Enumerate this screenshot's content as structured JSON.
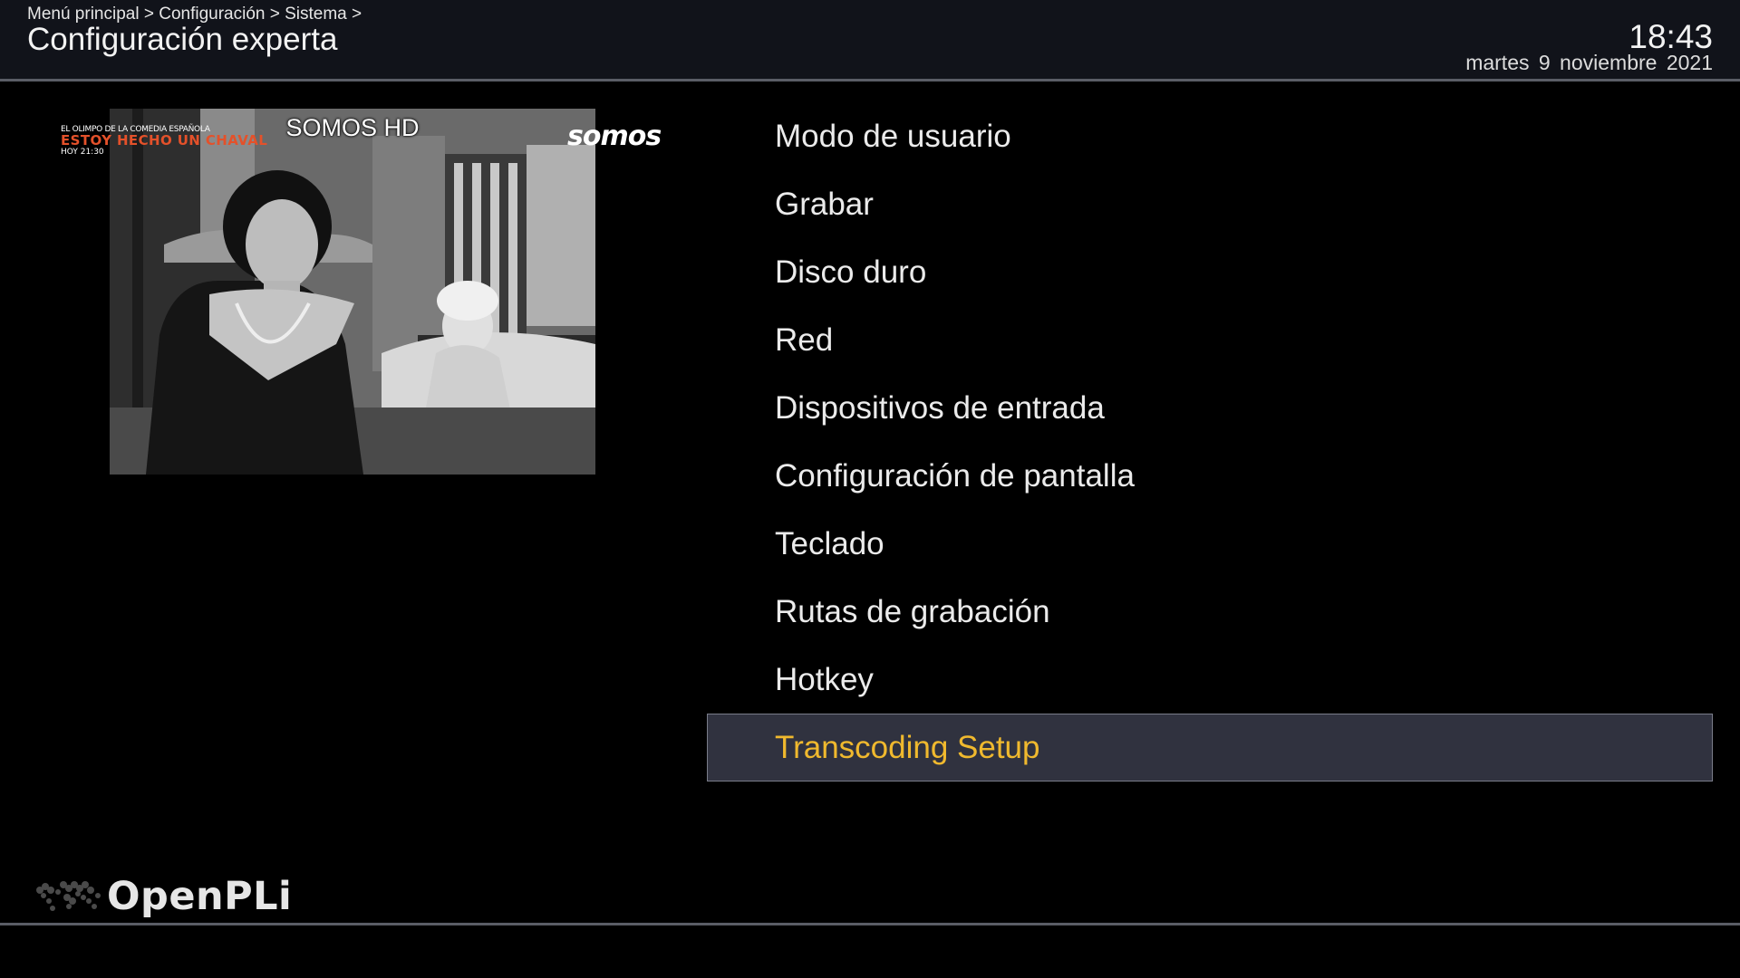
{
  "header": {
    "breadcrumb": "Menú principal > Configuración > Sistema >",
    "title": "Configuración experta",
    "time": "18:43",
    "date": "martes  9 noviembre 2021"
  },
  "preview": {
    "channel_name": "SOMOS HD",
    "promo_line1": "EL OLIMPO DE LA COMEDIA ESPAÑOLA",
    "promo_line2": "ESTOY HECHO UN CHAVAL",
    "promo_line3": "HOY 21:30",
    "channel_logo": "somos"
  },
  "menu": {
    "items": [
      {
        "label": "Modo de usuario"
      },
      {
        "label": "Grabar"
      },
      {
        "label": "Disco duro"
      },
      {
        "label": "Red"
      },
      {
        "label": "Dispositivos de entrada"
      },
      {
        "label": "Configuración de pantalla"
      },
      {
        "label": "Teclado"
      },
      {
        "label": "Rutas de grabación"
      },
      {
        "label": "Hotkey"
      },
      {
        "label": "Transcoding Setup"
      }
    ],
    "selected_index": 9
  },
  "footer": {
    "brand": "OpenPLi",
    "logo_icon": "world-map-icon"
  },
  "colors": {
    "header_bg": "#11131a",
    "selection_bg": "#30323f",
    "selection_text": "#f0b92e",
    "divider": "#5a5d66"
  }
}
